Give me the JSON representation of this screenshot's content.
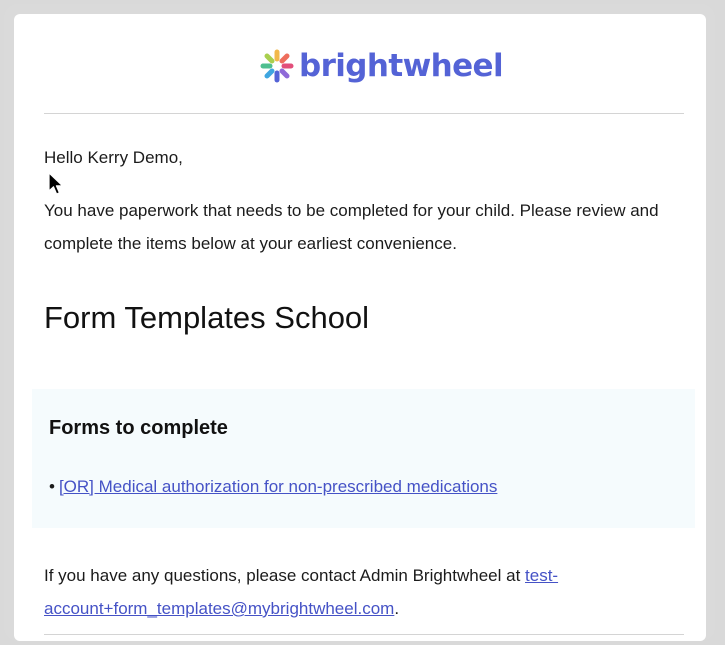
{
  "brand": {
    "name": "brightwheel",
    "color": "#5463d6",
    "logo_icon": "brightwheel-pinwheel-icon"
  },
  "email": {
    "greeting": "Hello Kerry Demo,",
    "intro": "You have paperwork that needs to be completed for your child. Please review and complete the items below at your earliest convenience.",
    "school_name": "Form Templates School",
    "forms_section": {
      "title": "Forms to complete",
      "bullet": "•",
      "items": [
        {
          "label": "[OR] Medical authorization for non-prescribed medications"
        }
      ]
    },
    "contact": {
      "prefix": "If you have any questions, please contact Admin Brightwheel at ",
      "email_line1": "test-",
      "email_line2": "account+form_templates@mybrightwheel.com",
      "suffix": "."
    }
  },
  "colors": {
    "link": "#4552c6",
    "panel_background": "#f5fbfd"
  }
}
